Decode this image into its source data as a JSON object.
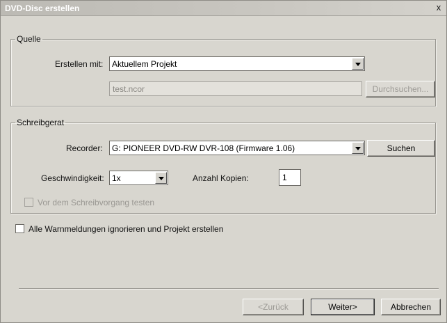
{
  "window": {
    "title": "DVD-Disc erstellen",
    "close_glyph": "x"
  },
  "source": {
    "legend": "Quelle",
    "create_with_label": "Erstellen mit:",
    "create_with_value": "Aktuellem Projekt",
    "file_value": "test.ncor",
    "browse_label": "Durchsuchen..."
  },
  "writer": {
    "legend": "Schreibgerat",
    "recorder_label": "Recorder:",
    "recorder_value": "G: PIONEER DVD-RW  DVR-108 (Firmware 1.06)",
    "search_label": "Suchen",
    "speed_label": "Geschwindigkeit:",
    "speed_value": "1x",
    "copies_label": "Anzahl Kopien:",
    "copies_value": "1",
    "test_label": "Vor dem Schreibvorgang testen"
  },
  "ignore_warnings_label": "Alle Warnmeldungen ignorieren und Projekt erstellen",
  "footer": {
    "back_label": "<Zurück",
    "next_label": "Weiter>",
    "cancel_label": "Abbrechen"
  }
}
